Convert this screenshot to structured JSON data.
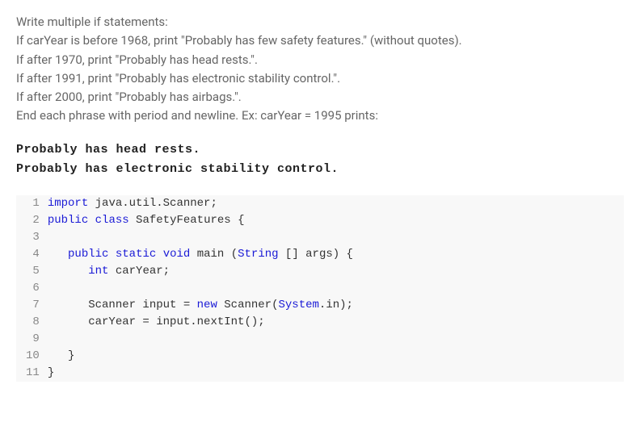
{
  "instructions": {
    "line1": "Write multiple if statements:",
    "line2": "If carYear is before 1968, print \"Probably has few safety features.\" (without quotes).",
    "line3": "If after 1970, print \"Probably has head rests.\".",
    "line4": "If after 1991, print \"Probably has electronic stability control.\".",
    "line5": "If after 2000, print \"Probably has airbags.\".",
    "line6": "End each phrase with period and newline. Ex: carYear = 1995 prints:"
  },
  "example": {
    "line1": "Probably has head rests.",
    "line2": "Probably has electronic stability control."
  },
  "gutter": {
    "n1": "1",
    "n2": "2",
    "n3": "3",
    "n4": "4",
    "n5": "5",
    "n6": "6",
    "n7": "7",
    "n8": "8",
    "n9": "9",
    "n10": "10",
    "n11": "11"
  },
  "code": {
    "l1_a": "import",
    "l1_b": " java.util.Scanner;",
    "l2_a": "public",
    "l2_b": " ",
    "l2_c": "class",
    "l2_d": " SafetyFeatures {",
    "l3": "",
    "l4_a": "   ",
    "l4_b": "public",
    "l4_c": " ",
    "l4_d": "static",
    "l4_e": " ",
    "l4_f": "void",
    "l4_g": " main (",
    "l4_h": "String",
    "l4_i": " [] args) {",
    "l5_a": "      ",
    "l5_b": "int",
    "l5_c": " carYear;",
    "l6": "",
    "l7_a": "      Scanner input = ",
    "l7_b": "new",
    "l7_c": " Scanner(",
    "l7_d": "System",
    "l7_e": ".in);",
    "l8": "      carYear = input.nextInt();",
    "l9": "",
    "l10": "   }",
    "l11": "}"
  }
}
